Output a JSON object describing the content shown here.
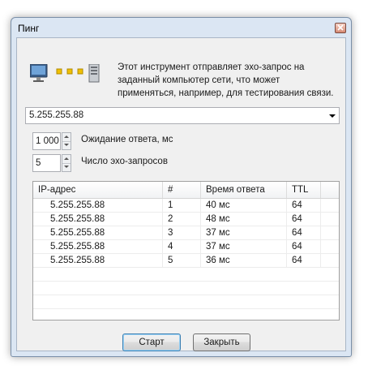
{
  "window": {
    "title": "Пинг"
  },
  "description": "Этот инструмент отправляет эхо-запрос на заданный компьютер сети, что может применяться, например, для тестирования связи.",
  "target": {
    "value": "5.255.255.88"
  },
  "timeout": {
    "value": "1 000",
    "label": "Ожидание ответа, мс"
  },
  "count": {
    "value": "5",
    "label": "Число эхо-запросов"
  },
  "table": {
    "headers": {
      "ip": "IP-адрес",
      "num": "#",
      "time": "Время ответа",
      "ttl": "TTL"
    },
    "rows": [
      {
        "ip": "5.255.255.88",
        "num": "1",
        "time": "40 мс",
        "ttl": "64"
      },
      {
        "ip": "5.255.255.88",
        "num": "2",
        "time": "48 мс",
        "ttl": "64"
      },
      {
        "ip": "5.255.255.88",
        "num": "3",
        "time": "37 мс",
        "ttl": "64"
      },
      {
        "ip": "5.255.255.88",
        "num": "4",
        "time": "37 мс",
        "ttl": "64"
      },
      {
        "ip": "5.255.255.88",
        "num": "5",
        "time": "36 мс",
        "ttl": "64"
      }
    ]
  },
  "buttons": {
    "start": "Старт",
    "close": "Закрыть"
  },
  "icons": {
    "computer": "monitor-icon",
    "packets": "packet-dots-icon",
    "server": "server-icon",
    "close": "close-icon"
  },
  "colors": {
    "packet": "#f0c000",
    "window_frame": "#dbe6f3",
    "default_button_border": "#3c7fb1"
  }
}
